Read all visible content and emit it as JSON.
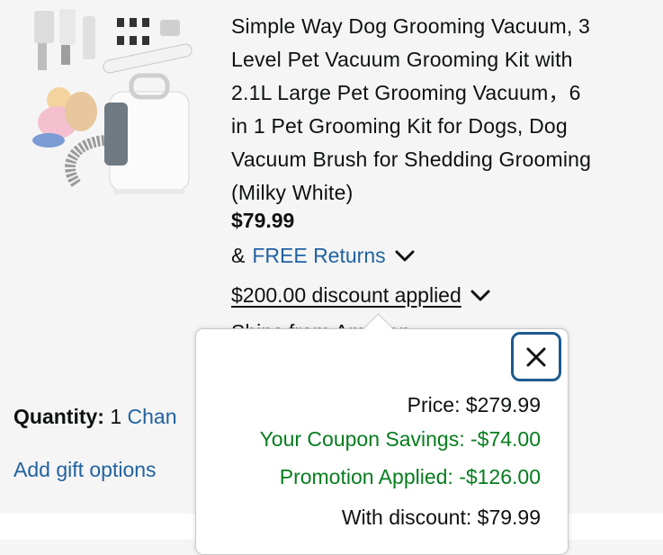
{
  "product": {
    "title": "Simple Way Dog Grooming Vacuum, 3 Level Pet Vacuum Grooming Kit with 2.1L Large Pet Grooming Vacuum，6 in 1 Pet Grooming Kit for Dogs, Dog Vacuum Brush for Shedding Grooming (Milky White)",
    "title_lines": [
      "Simple Way Dog Grooming Vacuum, 3",
      "Level Pet Vacuum Grooming Kit with",
      "2.1L Large Pet Grooming Vacuum，6",
      "in 1 Pet Grooming Kit for Dogs, Dog",
      "Vacuum Brush for Shedding Grooming",
      "(Milky White)"
    ],
    "price": "$79.99",
    "returns_prefix": "&",
    "returns_link": "FREE Returns",
    "discount_text": "$200.00 discount applied",
    "ships_from": "Ships from Amazon"
  },
  "quantity": {
    "label": "Quantity:",
    "value": "1",
    "change_link": "Chan"
  },
  "gift_link": "Add gift options",
  "popover": {
    "price_line": "Price: $279.99",
    "coupon_line": "Your Coupon Savings: -$74.00",
    "promotion_line": "Promotion Applied: -$126.00",
    "with_discount_line": "With discount: $79.99"
  },
  "colors": {
    "link": "#2162a1",
    "savings_green": "#067d1e",
    "close_focus": "#1d5a8e"
  },
  "icons": {
    "close": "close-x-icon",
    "chevron": "chevron-down-icon"
  }
}
